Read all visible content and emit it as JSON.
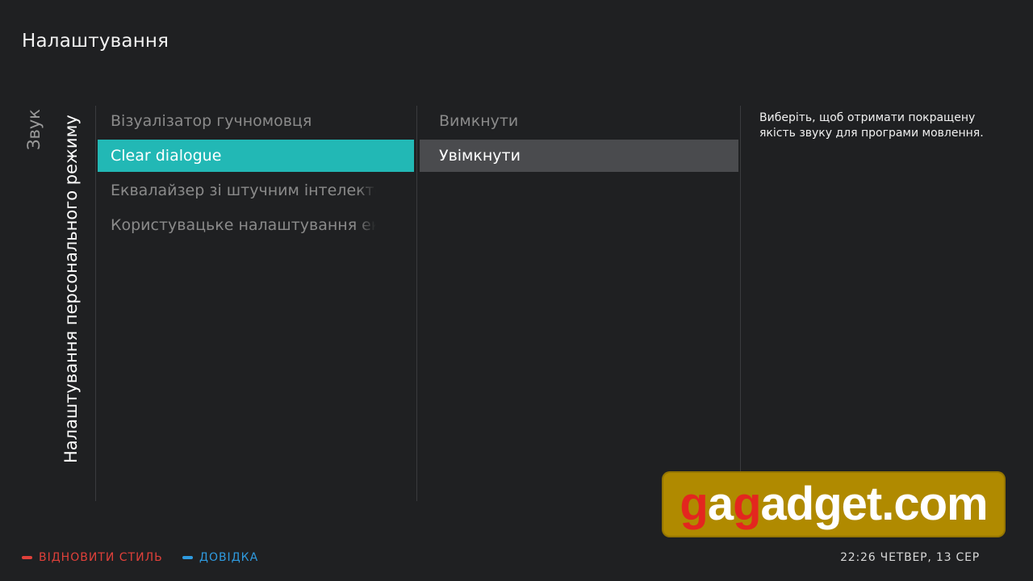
{
  "header": {
    "title": "Налаштування"
  },
  "breadcrumb": {
    "parent": "Звук",
    "current": "Налаштування персонального режиму"
  },
  "menu": {
    "items": [
      {
        "label": "Візуалізатор гучномовця",
        "selected": false
      },
      {
        "label": "Clear dialogue",
        "selected": true
      },
      {
        "label": "Еквалайзер зі штучним інтелектом",
        "selected": false
      },
      {
        "label": "Користувацьке налаштування еквалайзера",
        "selected": false
      }
    ]
  },
  "options": {
    "items": [
      {
        "label": "Вимкнути",
        "selected": false
      },
      {
        "label": "Увімкнути",
        "selected": true
      }
    ]
  },
  "help": {
    "text": "Виберіть, щоб отримати покращену якість звуку для програми мовлення."
  },
  "watermark": {
    "part1": "g",
    "part2": "a",
    "part3": "g",
    "part4": "adget.com"
  },
  "footer": {
    "red_action": "ВІДНОВИТИ СТИЛЬ",
    "blue_action": "ДОВІДКА",
    "clock": "22:26 ЧЕТВЕР, 13 СЕР"
  },
  "colors": {
    "background": "#1f2022",
    "accent_teal": "#22b8b5",
    "option_selected": "#4a4b4e",
    "red_key": "#e0403a",
    "blue_key": "#2f9be0",
    "watermark_bg": "#b08a00",
    "watermark_red": "#e3261f"
  }
}
